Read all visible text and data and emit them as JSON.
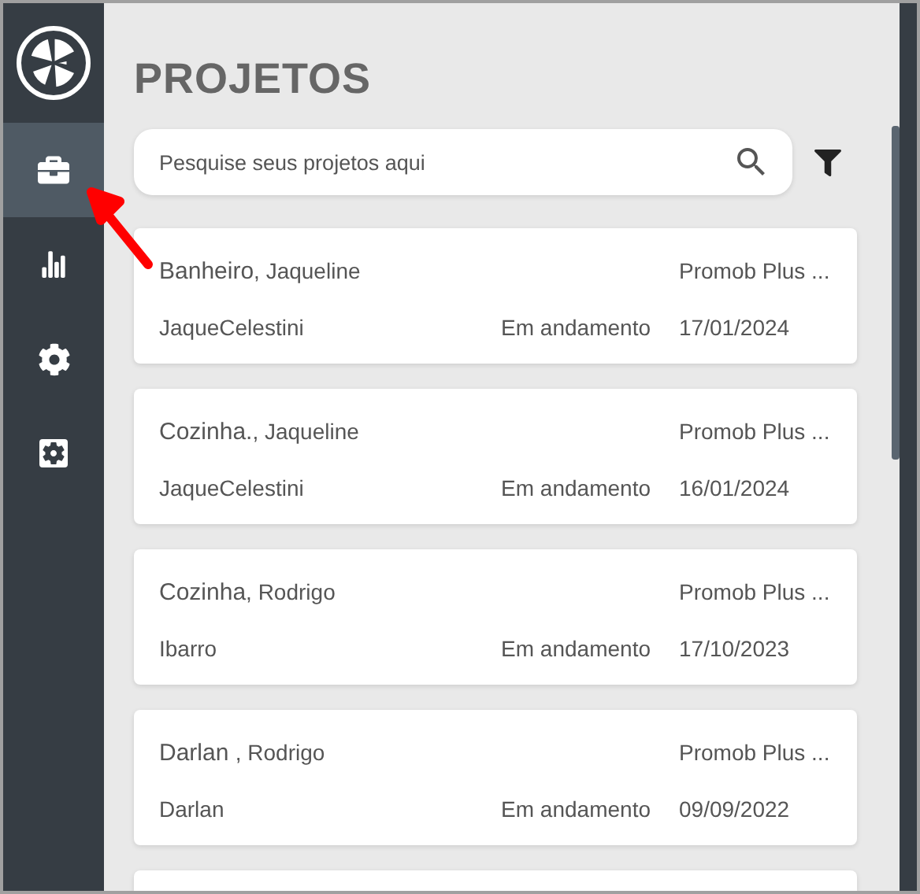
{
  "sidebar": {
    "items": [
      {
        "kind": "briefcase",
        "selected": true
      },
      {
        "kind": "chart",
        "selected": false
      },
      {
        "kind": "gear",
        "selected": false
      },
      {
        "kind": "panel",
        "selected": false
      }
    ]
  },
  "title": "PROJETOS",
  "search": {
    "placeholder": "Pesquise seus projetos aqui"
  },
  "projects": [
    {
      "room": "Banheiro",
      "client": ", Jaqueline",
      "software": "Promob Plus ...",
      "user": "JaqueCelestini",
      "status": "Em andamento",
      "date": "17/01/2024"
    },
    {
      "room": "Cozinha.",
      "client": ", Jaqueline",
      "software": "Promob Plus ...",
      "user": "JaqueCelestini",
      "status": "Em andamento",
      "date": "16/01/2024"
    },
    {
      "room": "Cozinha",
      "client": ", Rodrigo",
      "software": "Promob Plus ...",
      "user": "Ibarro",
      "status": "Em andamento",
      "date": "17/10/2023"
    },
    {
      "room": "Darlan ",
      "client": ", Rodrigo",
      "software": "Promob Plus ...",
      "user": "Darlan",
      "status": "Em andamento",
      "date": "09/09/2022"
    }
  ]
}
